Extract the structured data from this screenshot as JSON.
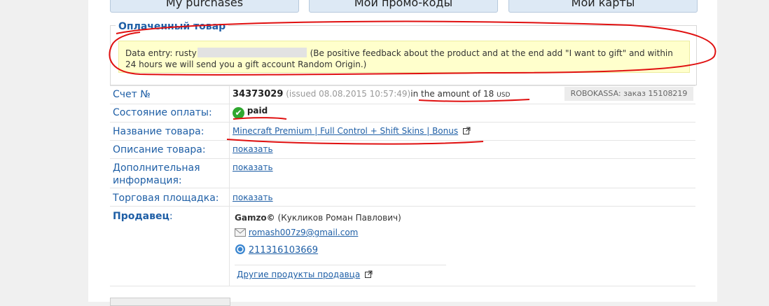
{
  "tabs": [
    "My purchases",
    "Мои промо-коды",
    "Мои карты"
  ],
  "purchase": {
    "section_title": "Оплаченный товар",
    "note_prefix": "Data entry: rusty",
    "note_text": "(Be positive feedback about the product and at the end add \"I want to gift\" and within 24 hours we will send you a gift account Random Origin.)"
  },
  "invoice": {
    "label": "Счет №",
    "number": "34373029",
    "issued": "(issued 08.08.2015 10:57:49)",
    "amount_prefix": "in the amount of",
    "amount": "18",
    "currency": "USD",
    "robokassa": "ROBOKASSA: заказ 15108219"
  },
  "payment": {
    "label": "Состояние оплаты:",
    "status": "paid"
  },
  "product": {
    "label": "Название товара:",
    "name": "Minecraft Premium | Full Control + Shift Skins | Bonus"
  },
  "description": {
    "label": "Описание товара:",
    "link": "показать"
  },
  "additional": {
    "label_line1": "Дополнительная",
    "label_line2": "информация:",
    "link": "показать"
  },
  "marketplace": {
    "label": "Торговая площадка:",
    "link": "показать"
  },
  "seller": {
    "label": "Продавец",
    "colon": ":",
    "nick": "Gamzo©",
    "full_name": "(Кукликов Роман Павлович)",
    "email": "romash007z9@gmail.com",
    "wmid": "211316103669",
    "other_products": "Другие продукты продавца"
  },
  "colors": {
    "link": "#1f5fa6",
    "note_bg": "#ffffcc",
    "paid_green": "#2fa82f",
    "annotation_red": "#e01010"
  }
}
